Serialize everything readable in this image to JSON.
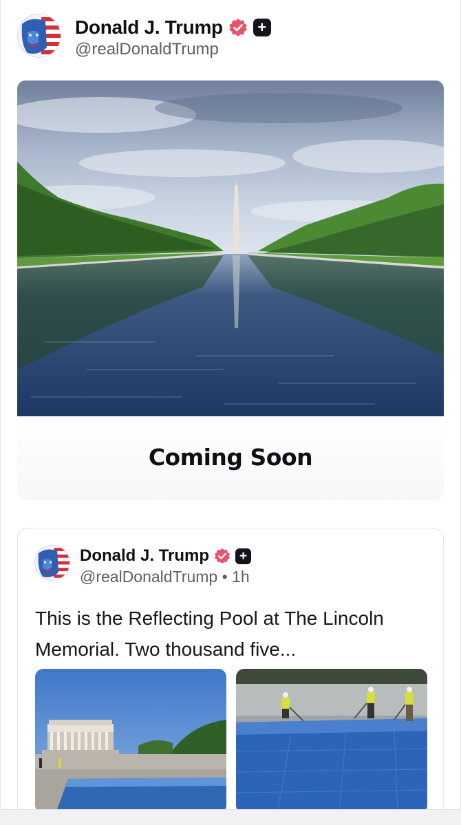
{
  "post": {
    "display_name": "Donald J. Trump",
    "handle": "@realDonaldTrump",
    "verified_badge_icon": "verified-badge-icon",
    "plus_badge_icon": "plus-badge-icon",
    "plus_badge_glyph": "+",
    "image": "washington-monument-reflecting-pool-photo",
    "caption": "Coming Soon"
  },
  "quoted_post": {
    "display_name": "Donald J. Trump",
    "handle": "@realDonaldTrump",
    "separator": "•",
    "time": "1h",
    "plus_badge_glyph": "+",
    "text": "This is the Reflecting Pool at The Lincoln Memorial. Two thousand five...",
    "media": [
      "lincoln-memorial-pool-photo",
      "workers-painting-pool-photo"
    ]
  },
  "colors": {
    "verified_badge": "#e9526a",
    "plus_badge": "#14141c",
    "handle_text": "#5d5d66"
  }
}
